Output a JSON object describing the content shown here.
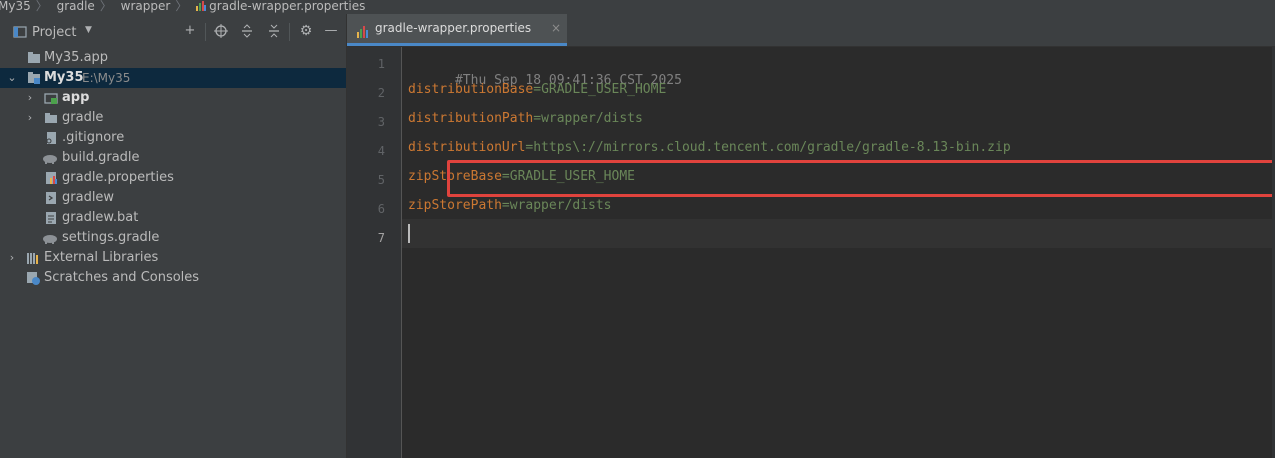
{
  "breadcrumbs": [
    "My35",
    "gradle",
    "wrapper",
    "gradle-wrapper.properties"
  ],
  "panel": {
    "title": "Project",
    "toolbar": [
      "add-icon",
      "target-icon",
      "expand-all-icon",
      "collapse-all-icon",
      "gear-icon",
      "minimize-icon"
    ]
  },
  "tree": [
    {
      "label": "My35.app",
      "icon": "module-icon",
      "indent": 0,
      "arrow": ""
    },
    {
      "label": "My35",
      "path": "E:\\My35",
      "icon": "project-folder-icon",
      "indent": 0,
      "arrow": "expanded",
      "selected": true,
      "bold": true
    },
    {
      "label": "app",
      "icon": "module-folder-icon",
      "indent": 1,
      "arrow": "collapsed",
      "bold": true
    },
    {
      "label": "gradle",
      "icon": "folder-icon",
      "indent": 1,
      "arrow": "collapsed"
    },
    {
      "label": ".gitignore",
      "icon": "gitignore-icon",
      "indent": 1,
      "arrow": ""
    },
    {
      "label": "build.gradle",
      "icon": "gradle-elephant-icon",
      "indent": 1,
      "arrow": ""
    },
    {
      "label": "gradle.properties",
      "icon": "properties-file-icon",
      "indent": 1,
      "arrow": ""
    },
    {
      "label": "gradlew",
      "icon": "script-file-icon",
      "indent": 1,
      "arrow": ""
    },
    {
      "label": "gradlew.bat",
      "icon": "text-file-icon",
      "indent": 1,
      "arrow": ""
    },
    {
      "label": "settings.gradle",
      "icon": "gradle-elephant-icon",
      "indent": 1,
      "arrow": ""
    },
    {
      "label": "External Libraries",
      "icon": "libraries-icon",
      "indent": 0,
      "arrow": "collapsed"
    },
    {
      "label": "Scratches and Consoles",
      "icon": "scratches-icon",
      "indent": 0,
      "arrow": ""
    }
  ],
  "editor": {
    "tab": {
      "label": "gradle-wrapper.properties",
      "icon": "properties-file-icon",
      "close": "×"
    },
    "lines": [
      {
        "n": "1",
        "comment": "#Thu Sep 18 09:41:36 CST 2025"
      },
      {
        "n": "2",
        "key": "distributionBase",
        "eq": "=",
        "value": "GRADLE_USER_HOME"
      },
      {
        "n": "3",
        "key": "distributionPath",
        "eq": "=",
        "value": "wrapper/dists"
      },
      {
        "n": "4",
        "key": "distributionUrl",
        "eq": "=",
        "value": "https\\://mirrors.cloud.tencent.com/gradle/gradle-8.13-bin.zip"
      },
      {
        "n": "5",
        "key": "zipStoreBase",
        "eq": "=",
        "value": "GRADLE_USER_HOME"
      },
      {
        "n": "6",
        "key": "zipStorePath",
        "eq": "=",
        "value": "wrapper/dists"
      },
      {
        "n": "7"
      }
    ],
    "highlight_color": "#e0433d"
  },
  "colors": {
    "key": "#cc7832",
    "value": "#6a8759",
    "comment": "#808080",
    "selection": "#0d293e"
  }
}
